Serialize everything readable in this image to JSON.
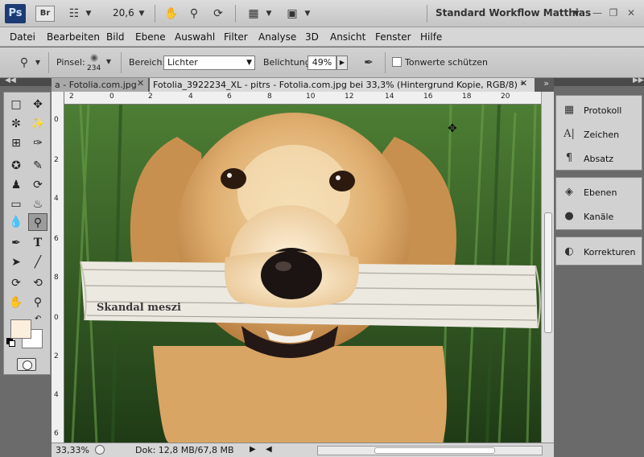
{
  "appbar": {
    "logo": "Ps",
    "bridge_label": "Br",
    "zoom_value": "20,6",
    "workspace_name": "Standard Workflow Matthias"
  },
  "menu": [
    "Datei",
    "Bearbeiten",
    "Bild",
    "Ebene",
    "Auswahl",
    "Filter",
    "Analyse",
    "3D",
    "Ansicht",
    "Fenster",
    "Hilfe"
  ],
  "options": {
    "brush_label": "Pinsel:",
    "brush_size": "234",
    "range_label": "Bereich:",
    "range_value": "Lichter",
    "exposure_label": "Belichtung:",
    "exposure_value": "49%",
    "protect_tones_label": "Tonwerte schützen"
  },
  "tabs": [
    {
      "label": "a - Fotolia.com.jpg",
      "active": false
    },
    {
      "label": "Fotolia_3922234_XL - pitrs - Fotolia.com.jpg bei 33,3% (Hintergrund Kopie, RGB/8) *",
      "active": true
    }
  ],
  "ruler_top": [
    "2",
    "0",
    "2",
    "4",
    "6",
    "8",
    "10",
    "12",
    "14",
    "16",
    "18",
    "20"
  ],
  "ruler_left": [
    "0",
    "2",
    "4",
    "6",
    "8",
    "0",
    "2",
    "4",
    "6"
  ],
  "newspaper_text": "Skandal meszi",
  "status": {
    "zoom": "33,33%",
    "doc": "Dok: 12,8 MB/67,8 MB"
  },
  "panels": {
    "group1": [
      {
        "label": "Protokoll",
        "icon": "history-icon"
      },
      {
        "label": "Zeichen",
        "icon": "character-icon"
      },
      {
        "label": "Absatz",
        "icon": "paragraph-icon"
      }
    ],
    "group2": [
      {
        "label": "Ebenen",
        "icon": "layers-icon"
      },
      {
        "label": "Kanäle",
        "icon": "channels-icon"
      }
    ],
    "group3": [
      {
        "label": "Korrekturen",
        "icon": "adjustments-icon"
      }
    ]
  },
  "colors": {
    "foreground": "#fdefdd",
    "background": "#ffffff"
  }
}
